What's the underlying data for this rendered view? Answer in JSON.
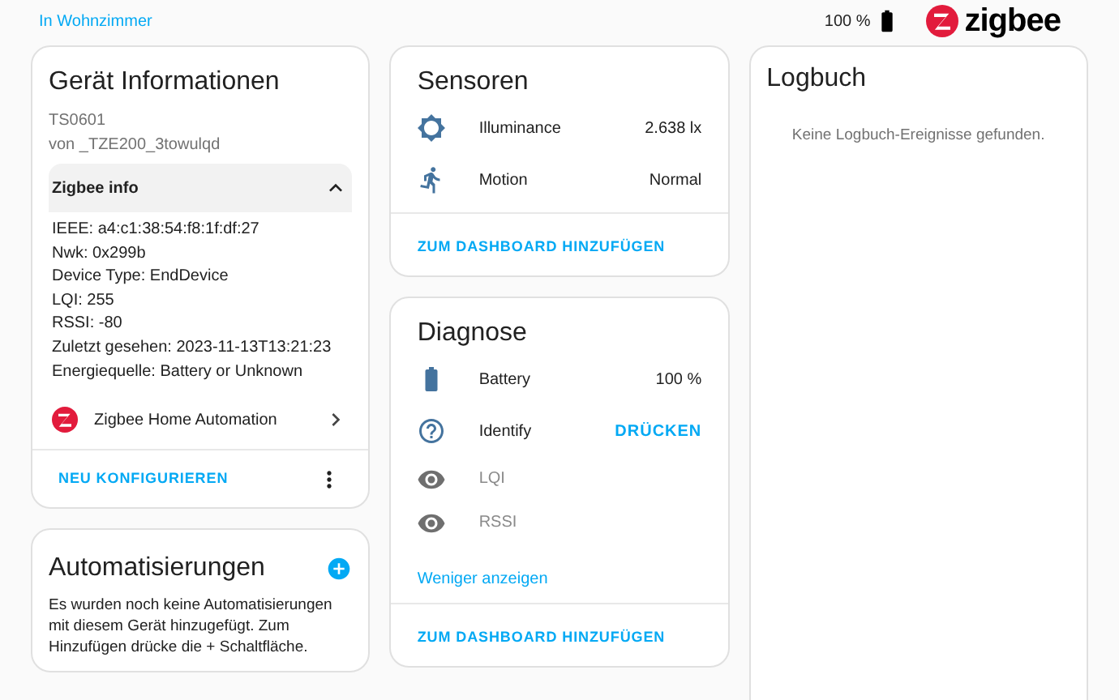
{
  "top_bar": {
    "area_link": "In Wohnzimmer",
    "battery": "100 %",
    "logo": "zigbee"
  },
  "device_info": {
    "title": "Gerät Informationen",
    "model": "TS0601",
    "manufacturer": "von _TZE200_3towulqd",
    "zigbee_info": {
      "title": "Zigbee info",
      "expanded": true,
      "lines": [
        "IEEE: a4:c1:38:54:f8:1f:df:27",
        "Nwk: 0x299b",
        "Device Type: EndDevice",
        "LQI: 255",
        "RSSI: -80",
        "Zuletzt gesehen: 2023-11-13T13:21:23",
        "Energiequelle: Battery or Unknown"
      ]
    },
    "integration": "Zigbee Home Automation",
    "action": "NEU KONFIGURIEREN"
  },
  "automations": {
    "title": "Automatisierungen",
    "text": "Es wurden noch keine Automatisierungen mit diesem Gerät hinzugefügt. Zum Hinzufügen drücke die + Schaltfläche."
  },
  "sensors": {
    "title": "Sensoren",
    "entities": [
      {
        "kind": "value",
        "name": "Illuminance",
        "value": "2.638 lx"
      },
      {
        "kind": "value",
        "name": "Motion",
        "value": "Normal"
      }
    ],
    "action": "ZUM DASHBOARD HINZUFÜGEN"
  },
  "diagnostics": {
    "title": "Diagnose",
    "entities": [
      {
        "kind": "value",
        "name": "Battery",
        "value": "100 %"
      },
      {
        "kind": "button",
        "name": "Identify",
        "value": "DRÜCKEN"
      },
      {
        "kind": "hidden",
        "name": "LQI"
      },
      {
        "kind": "hidden",
        "name": "RSSI"
      }
    ],
    "toggle": "Weniger anzeigen",
    "action": "ZUM DASHBOARD HINZUFÜGEN"
  },
  "logbook": {
    "title": "Logbuch",
    "empty": "Keine Logbuch-Ereignisse gefunden."
  }
}
